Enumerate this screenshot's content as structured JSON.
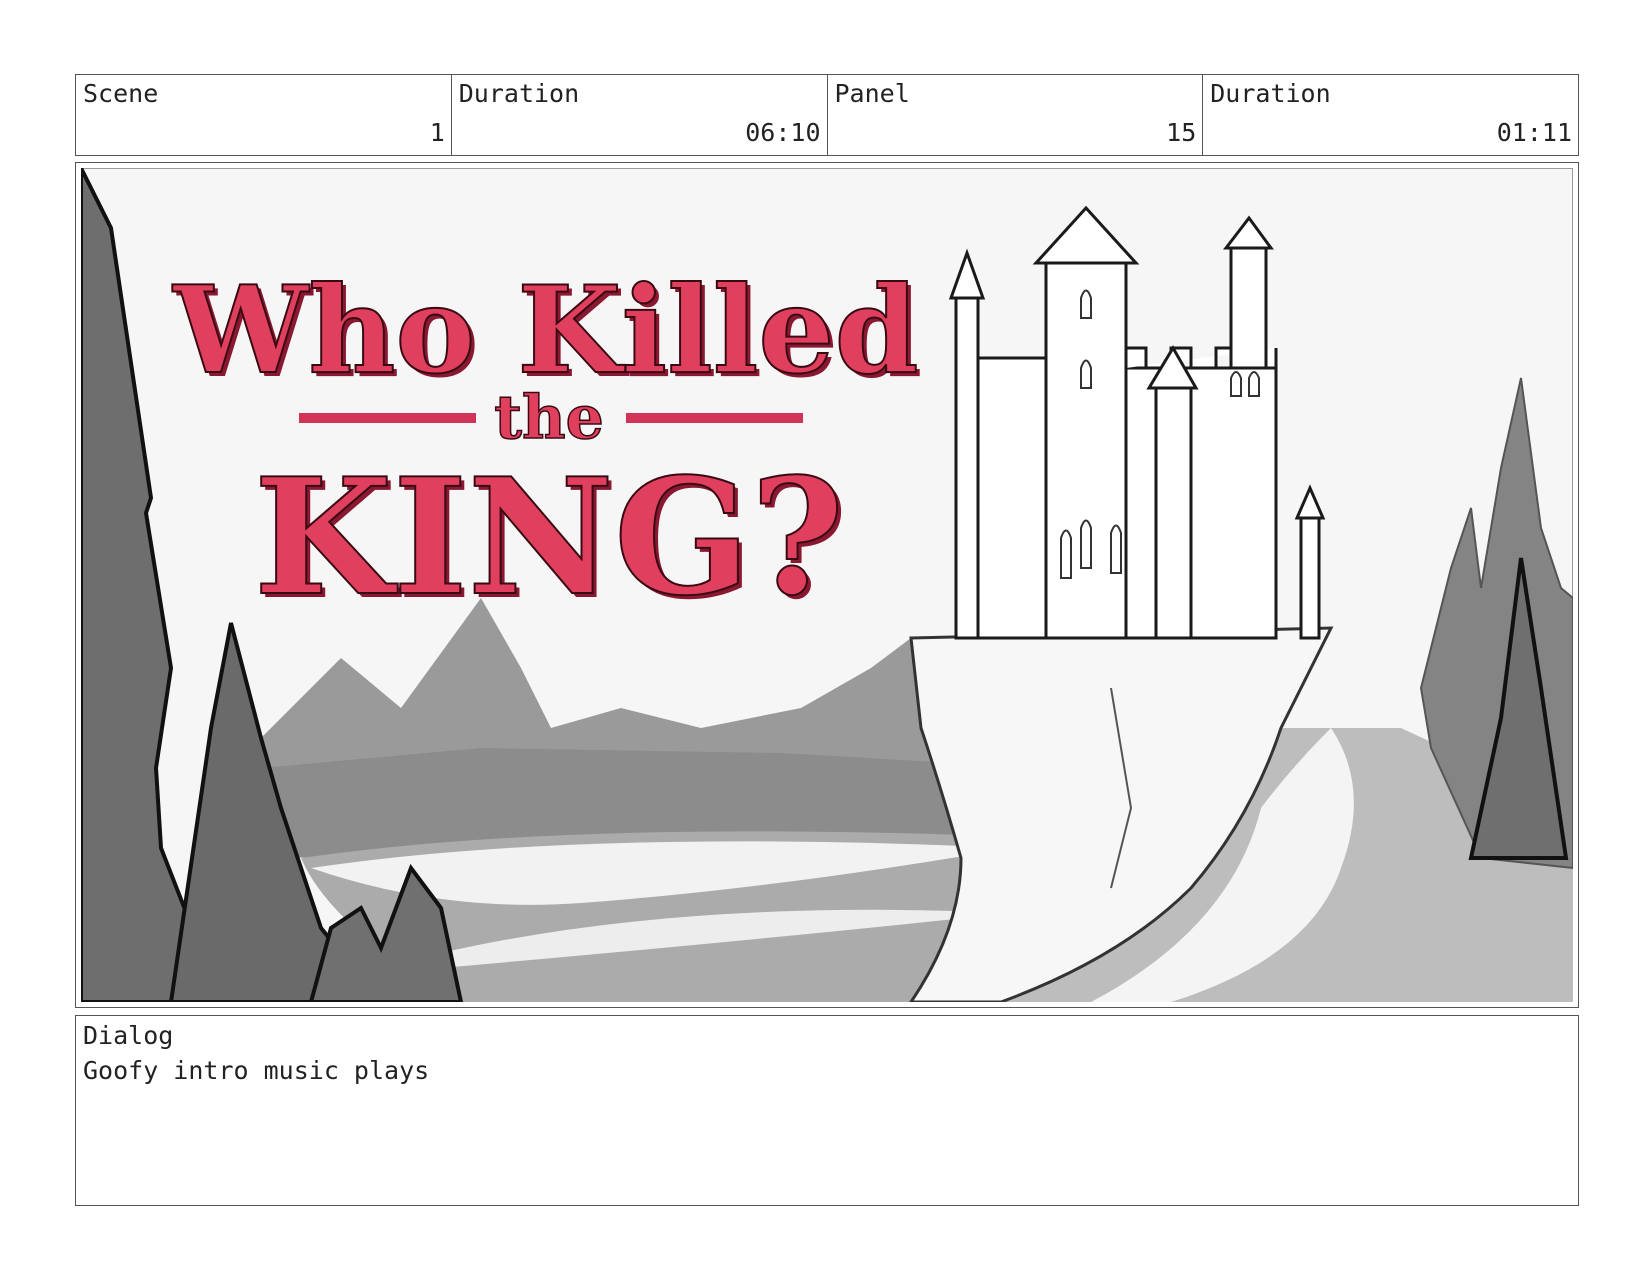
{
  "header": {
    "cells": [
      {
        "label": "Scene",
        "value": "1"
      },
      {
        "label": "Duration",
        "value": "06:10"
      },
      {
        "label": "Panel",
        "value": "15"
      },
      {
        "label": "Duration",
        "value": "01:11"
      }
    ]
  },
  "panel": {
    "title_line1": "Who Killed",
    "title_line2": "the",
    "title_line3": "KING?",
    "title_color": "#e0405e",
    "title_shadow_color": "#8a1830"
  },
  "dialog": {
    "label": "Dialog",
    "text": "Goofy intro music plays"
  }
}
